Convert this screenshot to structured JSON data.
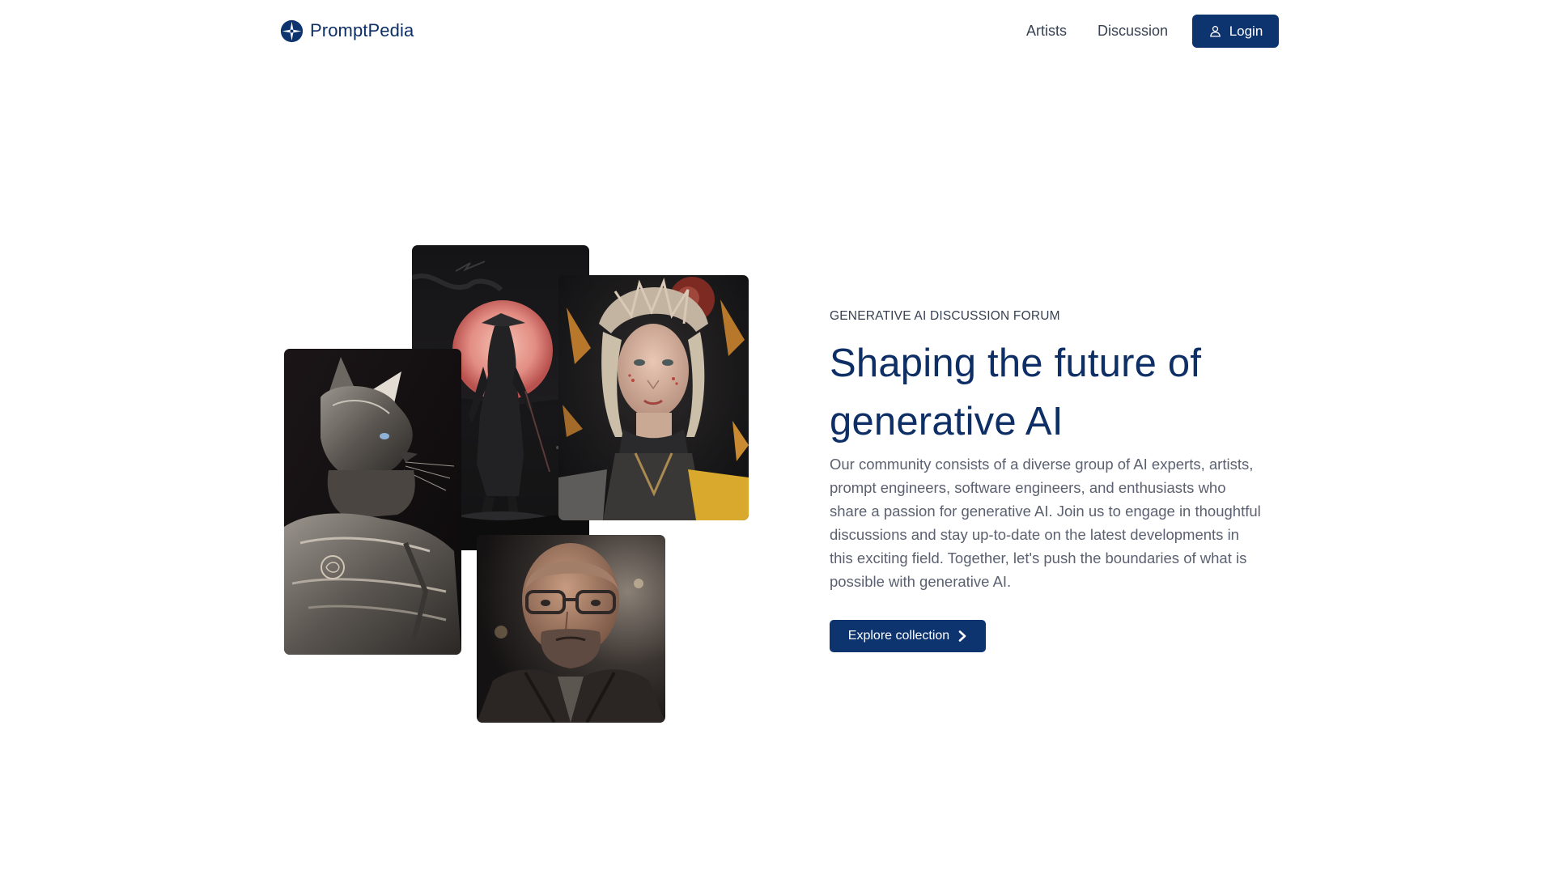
{
  "header": {
    "brand": "PromptPedia",
    "nav": [
      {
        "label": "Artists"
      },
      {
        "label": "Discussion"
      }
    ],
    "login_label": "Login"
  },
  "gallery": {
    "images": [
      {
        "subject": "samurai-moon-artwork"
      },
      {
        "subject": "flower-crown-woman-artwork"
      },
      {
        "subject": "armored-cat-artwork"
      },
      {
        "subject": "bearded-man-portrait"
      }
    ]
  },
  "hero": {
    "eyebrow": "GENERATIVE AI DISCUSSION FORUM",
    "title": "Shaping the future of generative AI",
    "body": "Our community consists of a diverse group of AI experts, artists, prompt engineers, software engineers, and enthusiasts who share a passion for generative AI. Join us to engage in thoughtful discussions and stay up-to-date on the latest developments in this exciting field. Together, let's push the boundaries of what is possible with generative AI.",
    "cta_label": "Explore collection"
  },
  "colors": {
    "primary": "#0e3470",
    "heading": "#0e2f66",
    "body_text": "#5b6170",
    "background": "#ffffff"
  },
  "icons": {
    "brand": "compass-star-icon",
    "login": "user-icon",
    "cta": "chevron-right-icon"
  }
}
